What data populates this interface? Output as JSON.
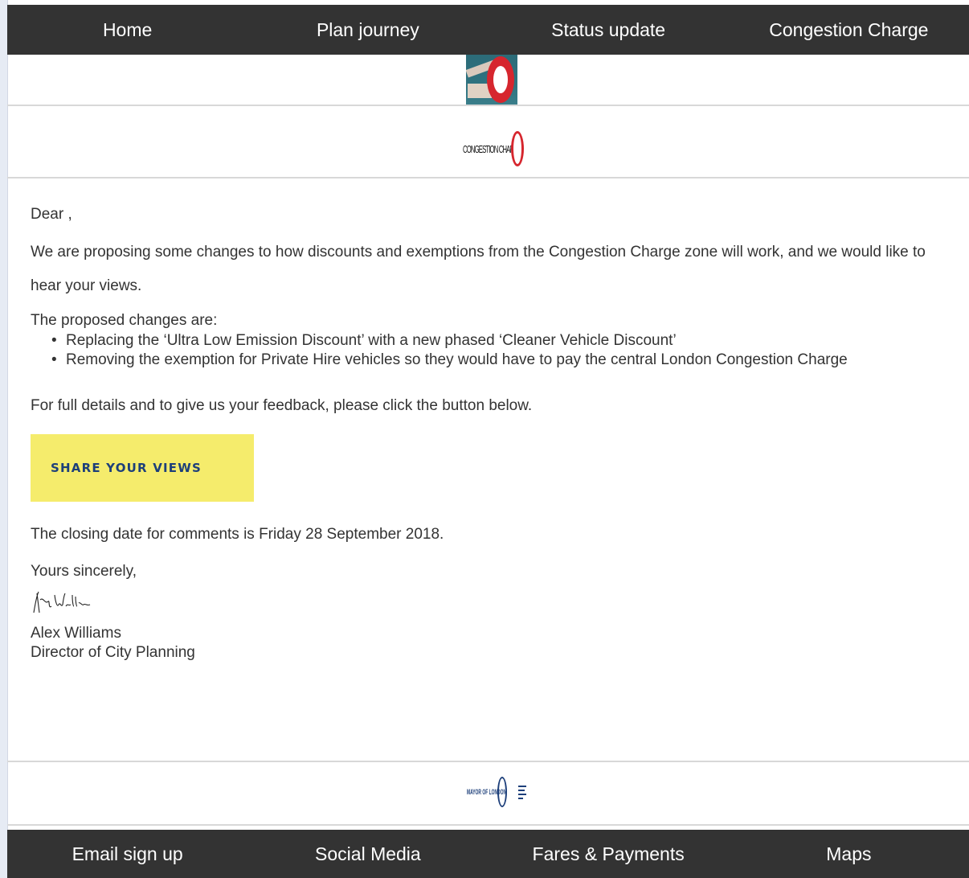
{
  "top_nav": {
    "items": [
      "Home",
      "Plan journey",
      "Status update",
      "Congestion Charge"
    ]
  },
  "logo": {
    "text": "CONGESTION CHARGE",
    "accent_color": "#d6262e"
  },
  "letter": {
    "greeting": "Dear ,",
    "intro": "We are proposing some changes to how discounts and exemptions from the Congestion Charge zone will work, and we would like to hear your views.",
    "changes_title": "The proposed changes are:",
    "changes": [
      "Replacing the ‘Ultra Low Emission Discount’ with a new phased ‘Cleaner Vehicle Discount’",
      "Removing the exemption for Private Hire vehicles so they would have to pay the central London Congestion Charge"
    ],
    "full_details": "For full details and to give us your feedback, please click the button below.",
    "cta_label": "SHARE YOUR VIEWS",
    "closing": "The closing date for comments is Friday 28 September 2018.",
    "sign_off": "Yours sincerely,",
    "signatory_name": "Alex Williams",
    "signatory_title": "Director of City Planning"
  },
  "footer_logo": {
    "left_text": "MAYOR OF LONDON",
    "right_text": "TRANSPORT FOR LONDON"
  },
  "bottom_nav": {
    "items": [
      "Email sign up",
      "Social Media",
      "Fares & Payments",
      "Maps"
    ]
  },
  "colors": {
    "nav_bg": "#333333",
    "cta_bg": "#f5ec6c",
    "cta_text": "#1d3f7a",
    "body_text": "#333333"
  }
}
